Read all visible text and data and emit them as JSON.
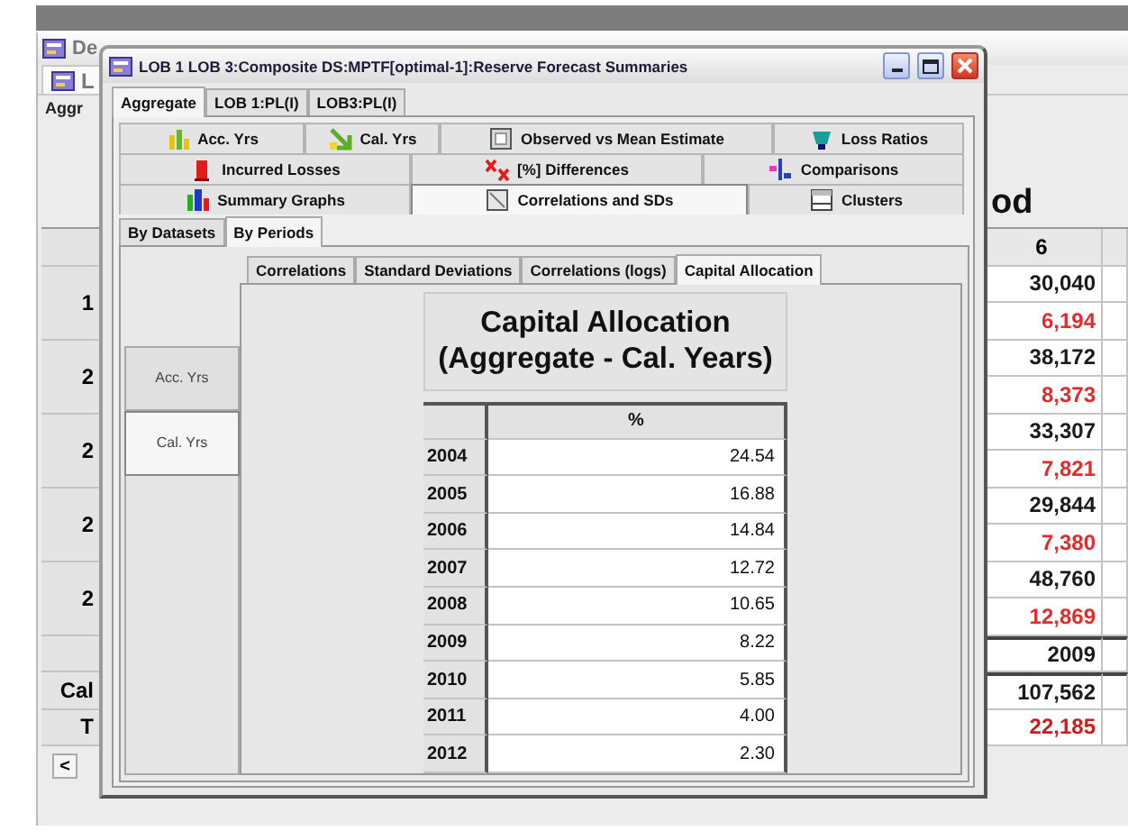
{
  "background_window": {
    "title": "De",
    "tab": "L",
    "subtab": "Aggr",
    "heading": "od",
    "column_header": "6",
    "row_labels": [
      {
        "kind": "group",
        "text": "1"
      },
      {
        "kind": "group",
        "text": "2"
      },
      {
        "kind": "group",
        "text": "2"
      },
      {
        "kind": "group",
        "text": "2"
      },
      {
        "kind": "group",
        "text": "2"
      },
      {
        "kind": "blank"
      },
      {
        "kind": "total",
        "text": "Cal"
      },
      {
        "kind": "total",
        "text": "T"
      }
    ],
    "values": [
      {
        "text": "30,040",
        "color": "#1a1a1a"
      },
      {
        "text": "6,194",
        "color": "#e42a2a"
      },
      {
        "text": "38,172",
        "color": "#1a1a1a"
      },
      {
        "text": "8,373",
        "color": "#e42a2a"
      },
      {
        "text": "33,307",
        "color": "#1a1a1a"
      },
      {
        "text": "7,821",
        "color": "#e42a2a"
      },
      {
        "text": "29,844",
        "color": "#1a1a1a"
      },
      {
        "text": "7,380",
        "color": "#e42a2a"
      },
      {
        "text": "48,760",
        "color": "#1a1a1a"
      },
      {
        "text": "12,869",
        "color": "#e42a2a"
      },
      {
        "text": "2009",
        "color": "#1a1a1a"
      },
      {
        "text": "107,562",
        "color": "#1a1a1a"
      },
      {
        "text": "22,185",
        "color": "#c81e1e"
      }
    ],
    "scroll_left": "<"
  },
  "window": {
    "title": "LOB 1 LOB 3:Composite DS:MPTF[optimal-1]:Reserve Forecast Summaries",
    "tabs": [
      {
        "label": "Aggregate",
        "selected": true
      },
      {
        "label": "LOB 1:PL(I)",
        "selected": false
      },
      {
        "label": "LOB3:PL(I)",
        "selected": false
      }
    ],
    "view_tabs": [
      [
        {
          "label": "Acc. Yrs",
          "selected": false
        },
        {
          "label": "Cal. Yrs",
          "selected": false
        },
        {
          "label": "Observed vs Mean Estimate",
          "selected": false
        },
        {
          "label": "Loss Ratios",
          "selected": false
        }
      ],
      [
        {
          "label": "Incurred Losses",
          "selected": false
        },
        {
          "label": "[%] Differences",
          "selected": false
        },
        {
          "label": "Comparisons",
          "selected": false
        }
      ],
      [
        {
          "label": "Summary Graphs",
          "selected": false
        },
        {
          "label": "Correlations and SDs",
          "selected": true
        },
        {
          "label": "Clusters",
          "selected": false
        }
      ]
    ],
    "group_tabs": [
      {
        "label": "By Datasets",
        "selected": false
      },
      {
        "label": "By Periods",
        "selected": true
      }
    ],
    "analysis_tabs": [
      {
        "label": "Correlations",
        "selected": false
      },
      {
        "label": "Standard Deviations",
        "selected": false
      },
      {
        "label": "Correlations (logs)",
        "selected": false
      },
      {
        "label": "Capital Allocation",
        "selected": true
      }
    ],
    "side_tabs": [
      {
        "label": "Acc. Yrs",
        "selected": false
      },
      {
        "label": "Cal. Yrs",
        "selected": true
      }
    ],
    "table": {
      "title_lines": [
        "Capital Allocation",
        "(Aggregate - Cal. Years)"
      ],
      "column": "%",
      "rows": [
        {
          "year": "2004",
          "value": "24.54"
        },
        {
          "year": "2005",
          "value": "16.88"
        },
        {
          "year": "2006",
          "value": "14.84"
        },
        {
          "year": "2007",
          "value": "12.72"
        },
        {
          "year": "2008",
          "value": "10.65"
        },
        {
          "year": "2009",
          "value": "8.22"
        },
        {
          "year": "2010",
          "value": "5.85"
        },
        {
          "year": "2011",
          "value": "4.00"
        },
        {
          "year": "2012",
          "value": "2.30"
        }
      ]
    }
  }
}
